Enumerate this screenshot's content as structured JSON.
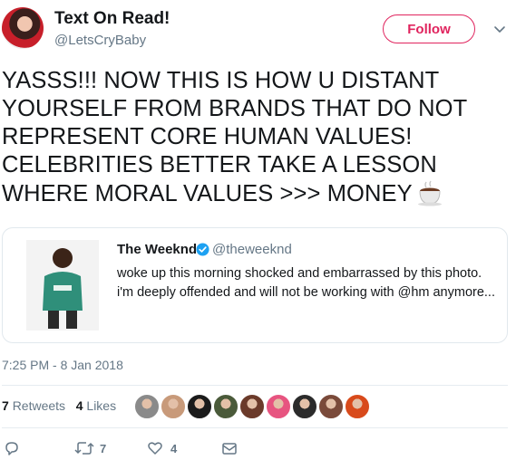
{
  "author": {
    "display_name": "Text On Read!",
    "handle": "@LetsCryBaby",
    "follow_label": "Follow"
  },
  "tweet": {
    "text": "YASSS!!! NOW THIS IS HOW U DISTANT YOURSELF FROM BRANDS THAT DO NOT REPRESENT CORE HUMAN VALUES! CELEBRITIES BETTER TAKE A LESSON WHERE MORAL VALUES >>> MONEY",
    "emoji_icon": "hot-beverage-icon",
    "timestamp": "7:25 PM - 8 Jan 2018"
  },
  "quoted_tweet": {
    "display_name": "The Weeknd",
    "handle": "@theweeknd",
    "verified_icon": "verified-badge-icon",
    "text": "woke up this morning shocked and embarrassed by this photo. i'm deeply offended and will not be working with @hm anymore..."
  },
  "stats": {
    "retweets_count": "7",
    "retweets_label": "Retweets",
    "likes_count": "4",
    "likes_label": "Likes"
  },
  "actions": {
    "retweet_count": "7",
    "like_count": "4"
  },
  "colors": {
    "follow_accent": "#e0245e",
    "secondary_text": "#657786",
    "verified_blue": "#1da1f2",
    "border": "#e1e8ed"
  },
  "liker_colors": [
    "#8a8a8a",
    "#c89a7a",
    "#1b1b1b",
    "#4a5a3a",
    "#6b3a2a",
    "#e75480",
    "#2b2b2b",
    "#7a4a3a",
    "#d84a1b"
  ]
}
